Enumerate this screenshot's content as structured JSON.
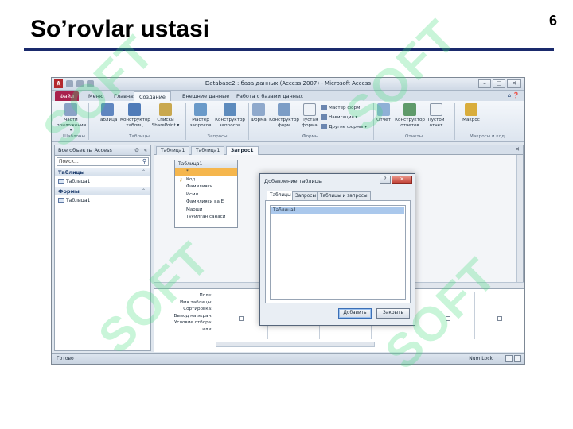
{
  "slide": {
    "title": "So’rovlar ustasi",
    "page_number": "6"
  },
  "watermark": {
    "text": "SOFT"
  },
  "window": {
    "title": "Database2 : база данных (Access 2007) - Microsoft Access",
    "controls": {
      "minimize": "–",
      "maximize": "□",
      "close": "✕"
    }
  },
  "ribbon": {
    "tabs": [
      "Файл",
      "Меню",
      "Главная",
      "Создание",
      "Внешние данные",
      "Работа с базами данных"
    ],
    "active_tab": "Создание",
    "buttons": {
      "app_parts": "Части приложения ▾",
      "table": "Таблица",
      "table_designer": "Конструктор таблиц",
      "sharepoint_lists": "Списки SharePoint ▾",
      "query_wizard": "Мастер запросов",
      "query_designer": "Конструктор запросов",
      "form": "Форма",
      "form_designer": "Конструктор форм",
      "blank_form": "Пустая форма",
      "form_wizard": "Мастер форм",
      "navigation": "Навигация ▾",
      "more_forms": "Другие формы ▾",
      "report": "Отчет",
      "report_designer": "Конструктор отчетов",
      "blank_report": "Пустой отчет",
      "macro": "Макрос"
    },
    "groups": {
      "templates": "Шаблоны",
      "tables": "Таблицы",
      "queries": "Запросы",
      "forms": "Формы",
      "reports": "Отчеты",
      "macros": "Макросы и код"
    }
  },
  "nav_pane": {
    "header": "Все объекты Access",
    "search_placeholder": "Поиск...",
    "groups": [
      {
        "label": "Таблицы",
        "items": [
          "Таблица1"
        ]
      },
      {
        "label": "Формы",
        "items": [
          "Таблица1"
        ]
      }
    ]
  },
  "document": {
    "tabs": [
      "Таблица1",
      "Таблица1",
      "Запрос1"
    ],
    "active_tab_index": 2,
    "table_box": {
      "title": "Таблица1",
      "fields": [
        "*",
        "Код",
        "Фамилияси",
        "Исми",
        "Фамилияси ва Е",
        "Маоши",
        "Туғилган санаси"
      ]
    },
    "query_grid_labels": [
      "Поле:",
      "Имя таблицы:",
      "Сортировка:",
      "Вывод на экран:",
      "Условие отбора:",
      "или:"
    ]
  },
  "status_bar": {
    "ready": "Готово",
    "num_lock": "Num Lock"
  },
  "dialog": {
    "title": "Добавление таблицы",
    "help": "?",
    "tabs": [
      "Таблицы",
      "Запросы",
      "Таблицы и запросы"
    ],
    "list_items": [
      "Таблица1"
    ],
    "add_button": "Добавить",
    "close_button": "Закрыть"
  }
}
